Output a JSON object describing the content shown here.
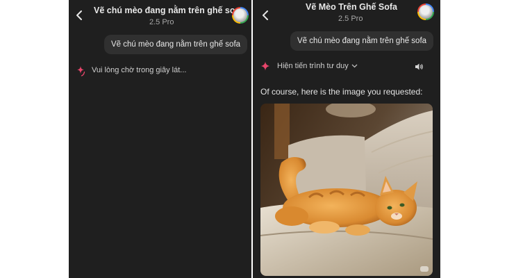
{
  "left_chat": {
    "title": "Vẽ chú mèo đang nằm trên ghế so...",
    "model": "2.5 Pro",
    "user_prompt": "Vẽ chú mèo đang nằm trên ghế sofa",
    "status_text": "Vui lòng chờ trong giây lát..."
  },
  "right_chat": {
    "title": "Vẽ Mèo Trên Ghế Sofa",
    "model": "2.5 Pro",
    "user_prompt": "Vẽ chú mèo đang nằm trên ghế sofa",
    "thinking_toggle": "Hiện tiến trình tư duy",
    "response_text": "Of course, here is the image you requested:",
    "image_alt": "Orange tabby cat lying on a cream sofa"
  },
  "icons": {
    "back": "back-arrow-icon",
    "avatar": "user-avatar",
    "spark": "gemini-spark-icon",
    "chevron": "chevron-down-icon",
    "speaker": "speaker-icon"
  },
  "colors": {
    "background": "#1f1f1f",
    "bubble": "#303030",
    "spark": "#e8456b"
  }
}
